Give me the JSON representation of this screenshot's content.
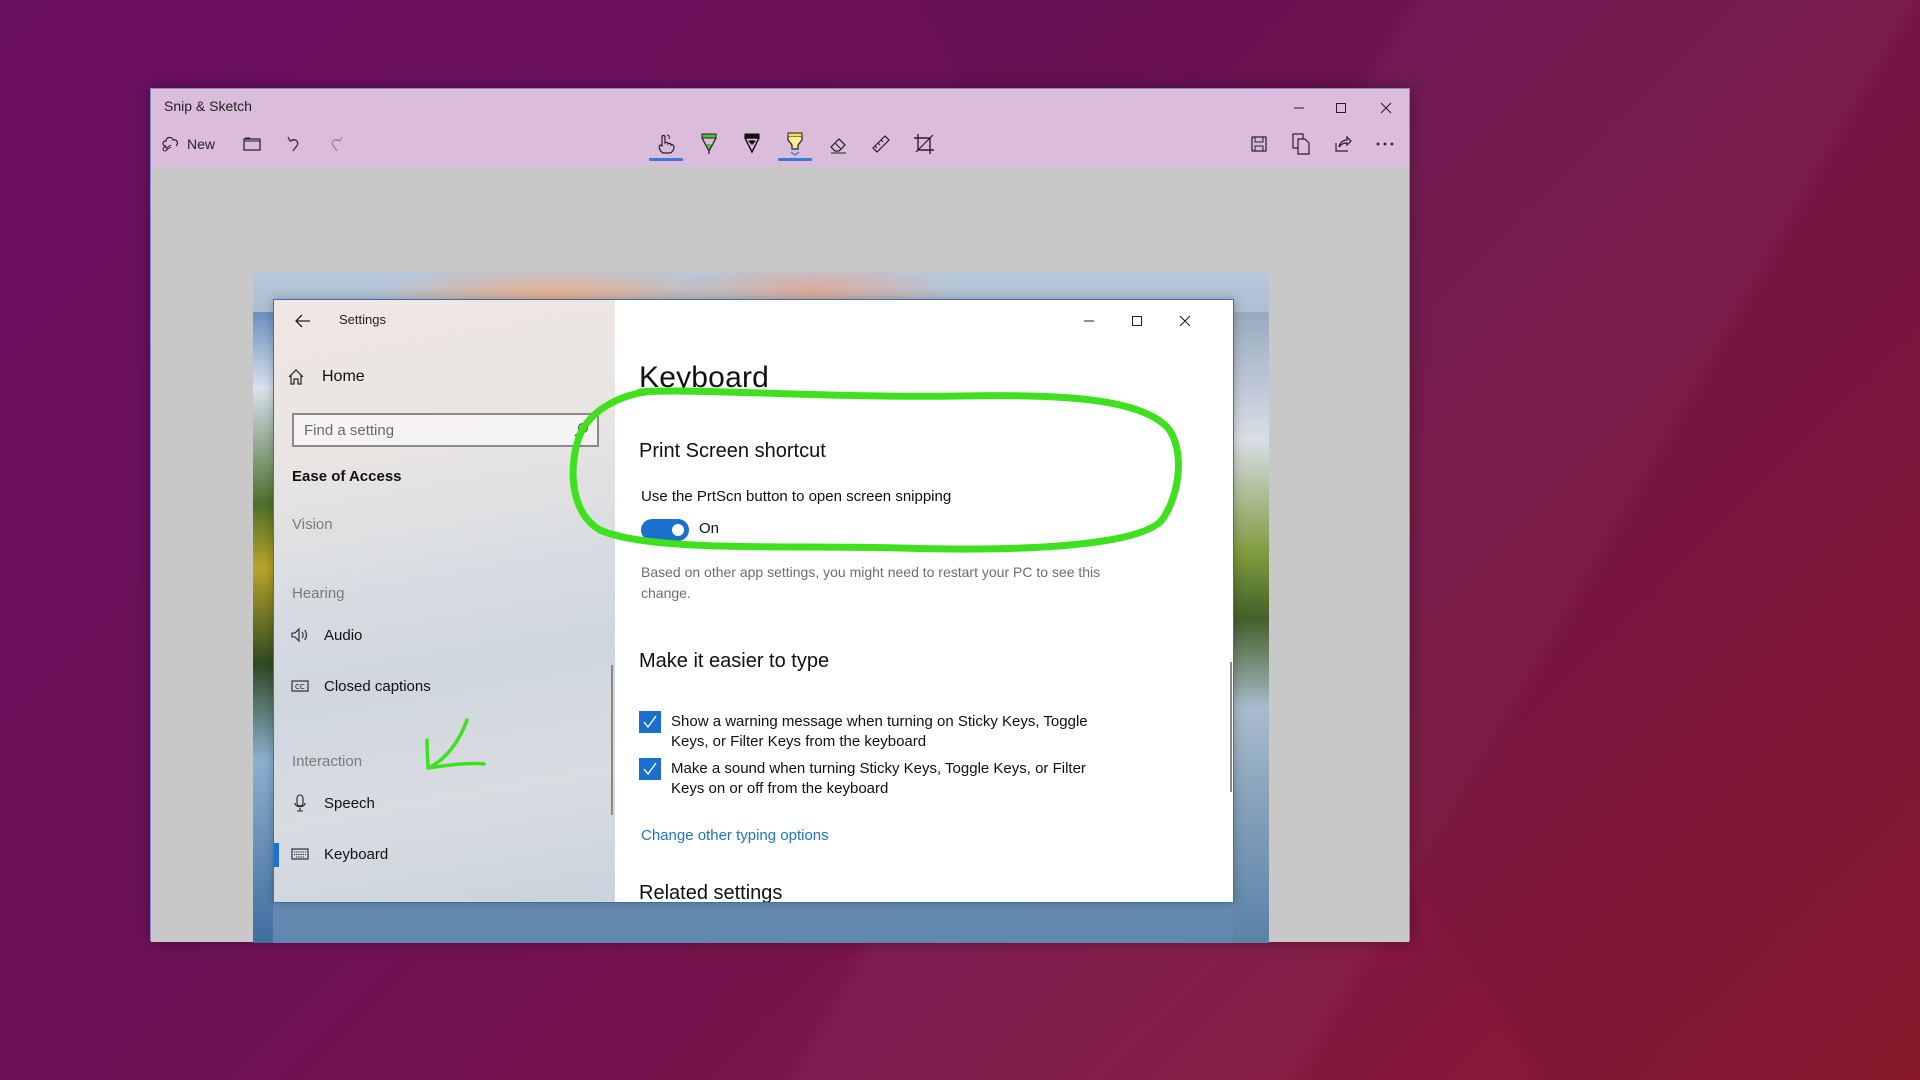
{
  "snip_window": {
    "title": "Snip & Sketch",
    "window_controls": {
      "minimize": "—",
      "maximize": "☐",
      "close": "✕"
    },
    "toolbar": {
      "new_label": "New",
      "left_tools": [
        {
          "name": "new-snip",
          "icon": "scissors-cloud-icon",
          "label": "New"
        },
        {
          "name": "open-file",
          "icon": "folder-icon"
        },
        {
          "name": "undo",
          "icon": "undo-icon"
        },
        {
          "name": "redo",
          "icon": "redo-icon",
          "disabled": true
        }
      ],
      "center_tools": [
        {
          "name": "touch-writing",
          "icon": "touch-hand-icon",
          "active": true
        },
        {
          "name": "ballpoint-pen",
          "icon": "pen-icon",
          "color": "#4cc43a"
        },
        {
          "name": "pencil",
          "icon": "pencil-icon",
          "color": "#111111"
        },
        {
          "name": "highlighter",
          "icon": "highlighter-icon",
          "color": "#f2e14a",
          "active": true
        },
        {
          "name": "eraser",
          "icon": "eraser-icon"
        },
        {
          "name": "ruler",
          "icon": "ruler-icon"
        },
        {
          "name": "crop",
          "icon": "crop-icon"
        }
      ],
      "right_tools": [
        {
          "name": "save",
          "icon": "save-icon"
        },
        {
          "name": "copy",
          "icon": "copy-icon"
        },
        {
          "name": "share",
          "icon": "share-icon"
        },
        {
          "name": "more",
          "icon": "more-icon",
          "label": "..."
        }
      ]
    }
  },
  "settings_window": {
    "title": "Settings",
    "window_controls": {
      "minimize": "—",
      "maximize": "☐",
      "close": "✕"
    },
    "sidebar": {
      "home_label": "Home",
      "search_placeholder": "Find a setting",
      "section_title": "Ease of Access",
      "groups": {
        "vision": "Vision",
        "hearing": "Hearing",
        "interaction": "Interaction"
      },
      "items": [
        {
          "label": "Audio",
          "icon": "speaker-icon"
        },
        {
          "label": "Closed captions",
          "icon": "closed-captions-icon"
        },
        {
          "label": "Speech",
          "icon": "microphone-icon"
        },
        {
          "label": "Keyboard",
          "icon": "keyboard-icon",
          "active": true
        }
      ]
    },
    "main": {
      "page_title": "Keyboard",
      "print_screen": {
        "heading": "Print Screen shortcut",
        "description": "Use the PrtScn button to open screen snipping",
        "toggle_on": true,
        "toggle_label": "On",
        "note": "Based on other app settings, you might need to restart your PC to see this change."
      },
      "easier_to_type": {
        "heading": "Make it easier to type",
        "checkboxes": [
          {
            "label": "Show a warning message when turning on Sticky Keys, Toggle Keys, or Filter Keys from the keyboard",
            "checked": true
          },
          {
            "label": "Make a sound when turning Sticky Keys, Toggle Keys, or Filter Keys on or off from the keyboard",
            "checked": true
          }
        ],
        "link": "Change other typing options"
      },
      "related_heading": "Related settings"
    }
  },
  "annotations": {
    "ink_color": "#3fe01e",
    "items": [
      "circle around Print Screen shortcut toggle",
      "arrow pointing to Keyboard sidebar item"
    ]
  },
  "colors": {
    "accent": "#1a6fcf",
    "link": "#1f74c2",
    "snip_titlebar": "#dcbcdb",
    "canvas": "#c8c8c8"
  }
}
